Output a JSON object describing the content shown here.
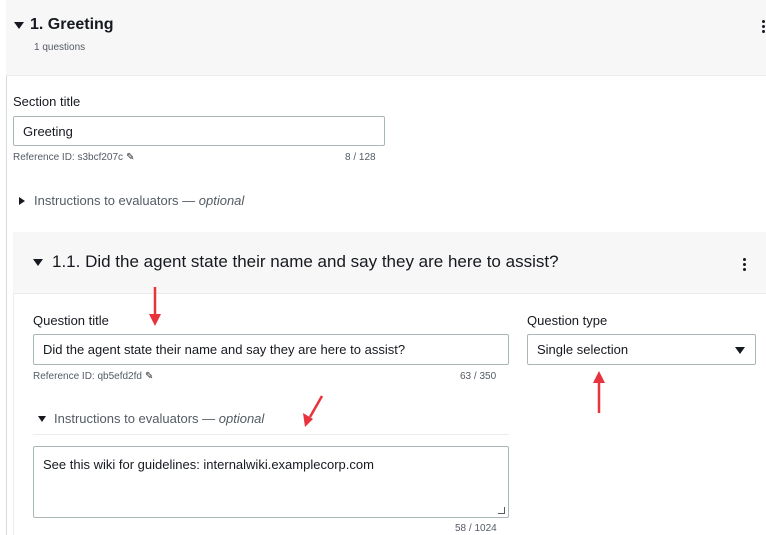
{
  "section": {
    "title": "1. Greeting",
    "subtitle": "1 questions",
    "section_title_label": "Section title",
    "section_title_value": "Greeting",
    "reference_id": "Reference ID: s3bcf207c",
    "char_count": "8 / 128",
    "instructions_label": "Instructions to evaluators",
    "instructions_dash": " — ",
    "optional": "optional"
  },
  "question": {
    "title": "1.1. Did the agent state their name and say they are here to assist?",
    "question_title_label": "Question title",
    "question_title_value": "Did the agent state their name and say they are here to assist?",
    "reference_id": "Reference ID: qb5efd2fd",
    "char_count": "63 / 350",
    "question_type_label": "Question type",
    "question_type_value": "Single selection",
    "instructions_label": "Instructions to evaluators",
    "instructions_dash": " — ",
    "optional": "optional",
    "instructions_value": "See this wiki for guidelines: internalwiki.examplecorp.com",
    "instructions_count": "58 / 1024"
  },
  "colors": {
    "annotation_arrow": "#e8323c",
    "header_bg": "#f7f7f7"
  },
  "icons": [
    "caret-down-icon",
    "caret-right-icon",
    "kebab-menu-icon",
    "pencil-icon",
    "resize-handle-icon"
  ]
}
